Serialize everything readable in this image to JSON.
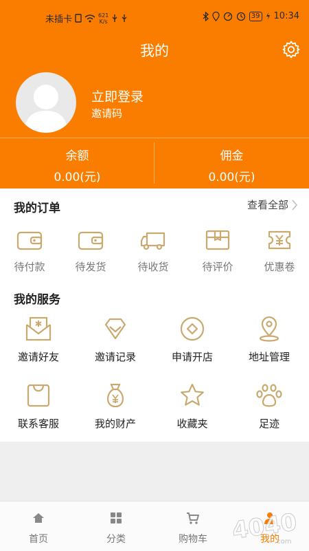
{
  "status_bar": {
    "carrier": "未插卡",
    "net_speed_value": "621",
    "net_speed_unit": "K/s",
    "battery": "39",
    "time": "10:34"
  },
  "header": {
    "title": "我的",
    "login_text": "立即登录",
    "invite_code_label": "邀请码"
  },
  "wallet": {
    "balance_label": "余额",
    "balance_value": "0.00(元)",
    "commission_label": "佣金",
    "commission_value": "0.00(元)"
  },
  "orders": {
    "title": "我的订单",
    "view_all": "查看全部",
    "items": [
      {
        "label": "待付款",
        "icon": "wallet-icon"
      },
      {
        "label": "待发货",
        "icon": "wallet-icon"
      },
      {
        "label": "待收货",
        "icon": "truck-icon"
      },
      {
        "label": "待评价",
        "icon": "box-icon"
      },
      {
        "label": "优惠卷",
        "icon": "coupon-icon"
      }
    ]
  },
  "services": {
    "title": "我的服务",
    "items": [
      {
        "label": "邀请好友",
        "icon": "envelope-icon"
      },
      {
        "label": "邀请记录",
        "icon": "diamond-icon"
      },
      {
        "label": "申请开店",
        "icon": "shop-icon"
      },
      {
        "label": "地址管理",
        "icon": "location-icon"
      },
      {
        "label": "联系客服",
        "icon": "bag-icon"
      },
      {
        "label": "我的财产",
        "icon": "money-bag-icon"
      },
      {
        "label": "收藏夹",
        "icon": "star-icon"
      },
      {
        "label": "足迹",
        "icon": "paw-icon"
      }
    ]
  },
  "tabbar": {
    "items": [
      {
        "label": "首页",
        "icon": "home-icon"
      },
      {
        "label": "分类",
        "icon": "grid-icon"
      },
      {
        "label": "购物车",
        "icon": "cart-icon"
      },
      {
        "label": "我的",
        "icon": "user-icon"
      }
    ]
  },
  "colors": {
    "accent": "#fa7d00",
    "icon_gold": "#c9a96e"
  }
}
